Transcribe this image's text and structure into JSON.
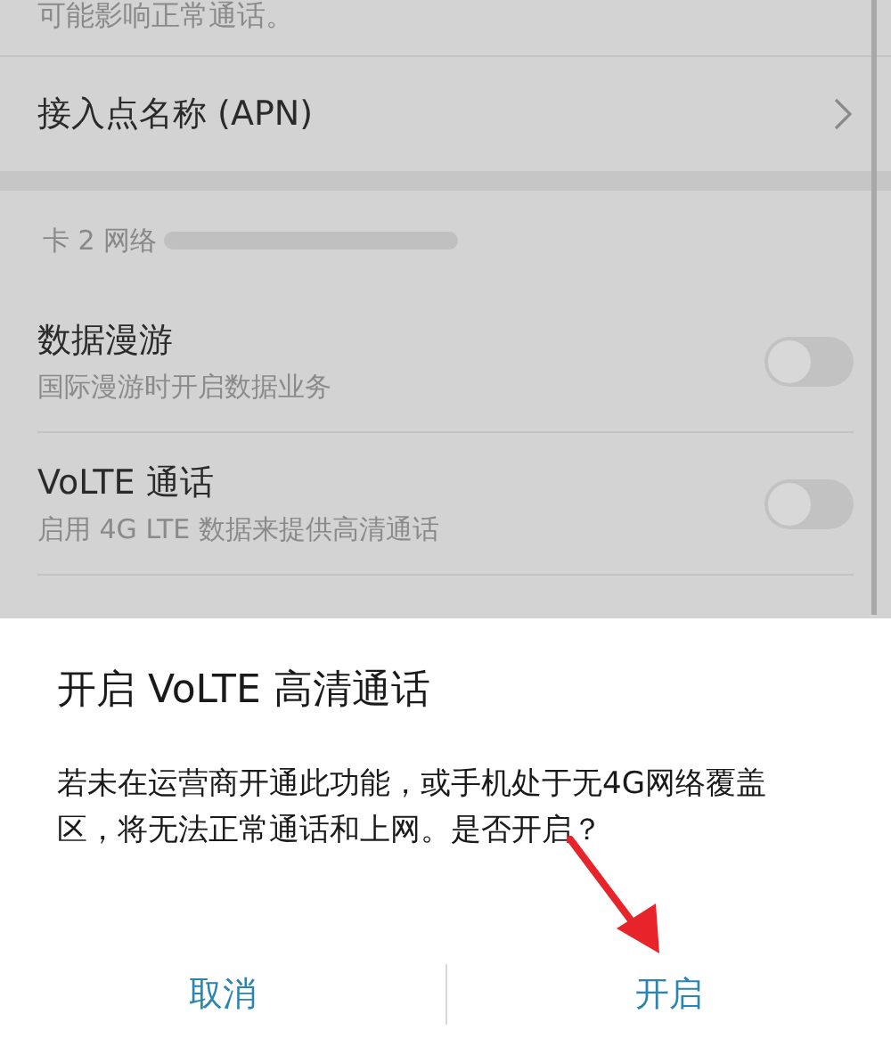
{
  "settings": {
    "note": "可能影响正常通话。",
    "apn_row": {
      "label": "接入点名称 (APN)"
    },
    "section_header": "卡 2 网络",
    "toggles": [
      {
        "title": "数据漫游",
        "subtitle": "国际漫游时开启数据业务",
        "on": false
      },
      {
        "title": "VoLTE 通话",
        "subtitle": "启用 4G LTE 数据来提供高清通话",
        "on": false
      }
    ]
  },
  "dialog": {
    "title": "开启 VoLTE 高清通话",
    "message": "若未在运营商开通此功能，或手机处于无4G网络覆盖区，将无法正常通话和上网。是否开启？",
    "buttons": [
      {
        "label": "取消"
      },
      {
        "label": "开启"
      }
    ]
  }
}
